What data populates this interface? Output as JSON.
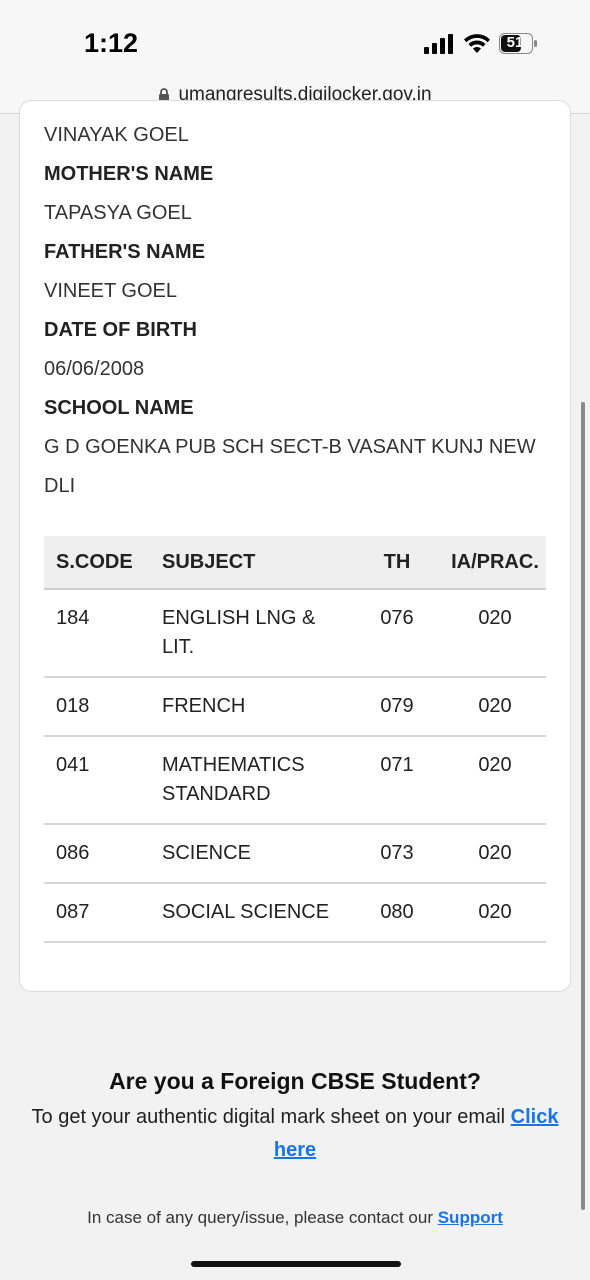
{
  "status_bar": {
    "time": "1:12",
    "battery": "51"
  },
  "browser": {
    "url": "umangresults.digilocker.gov.in"
  },
  "student": {
    "name_value": "VINAYAK GOEL",
    "mother_label": "MOTHER'S NAME",
    "mother_value": "TAPASYA GOEL",
    "father_label": "FATHER'S NAME",
    "father_value": "VINEET GOEL",
    "dob_label": "DATE OF BIRTH",
    "dob_value": "06/06/2008",
    "school_label": "SCHOOL NAME",
    "school_value": "G D GOENKA PUB SCH SECT-B VASANT KUNJ NEW DLI"
  },
  "marks_table": {
    "headers": {
      "code": "S.CODE",
      "subject": "SUBJECT",
      "th": "TH",
      "ia": "IA/PRAC."
    },
    "rows": [
      {
        "code": "184",
        "subject": "ENGLISH LNG & LIT.",
        "th": "076",
        "ia": "020"
      },
      {
        "code": "018",
        "subject": "FRENCH",
        "th": "079",
        "ia": "020"
      },
      {
        "code": "041",
        "subject": "MATHEMATICS STANDARD",
        "th": "071",
        "ia": "020"
      },
      {
        "code": "086",
        "subject": "SCIENCE",
        "th": "073",
        "ia": "020"
      },
      {
        "code": "087",
        "subject": "SOCIAL SCIENCE",
        "th": "080",
        "ia": "020"
      }
    ]
  },
  "foreign": {
    "title": "Are you a Foreign CBSE Student?",
    "text": "To get your authentic digital mark sheet on your email",
    "link": "Click here"
  },
  "contact": {
    "text": "In case of any query/issue, please contact our",
    "link": "Support"
  },
  "colors": {
    "link": "#1a73e8",
    "header_bg": "#efefef"
  }
}
